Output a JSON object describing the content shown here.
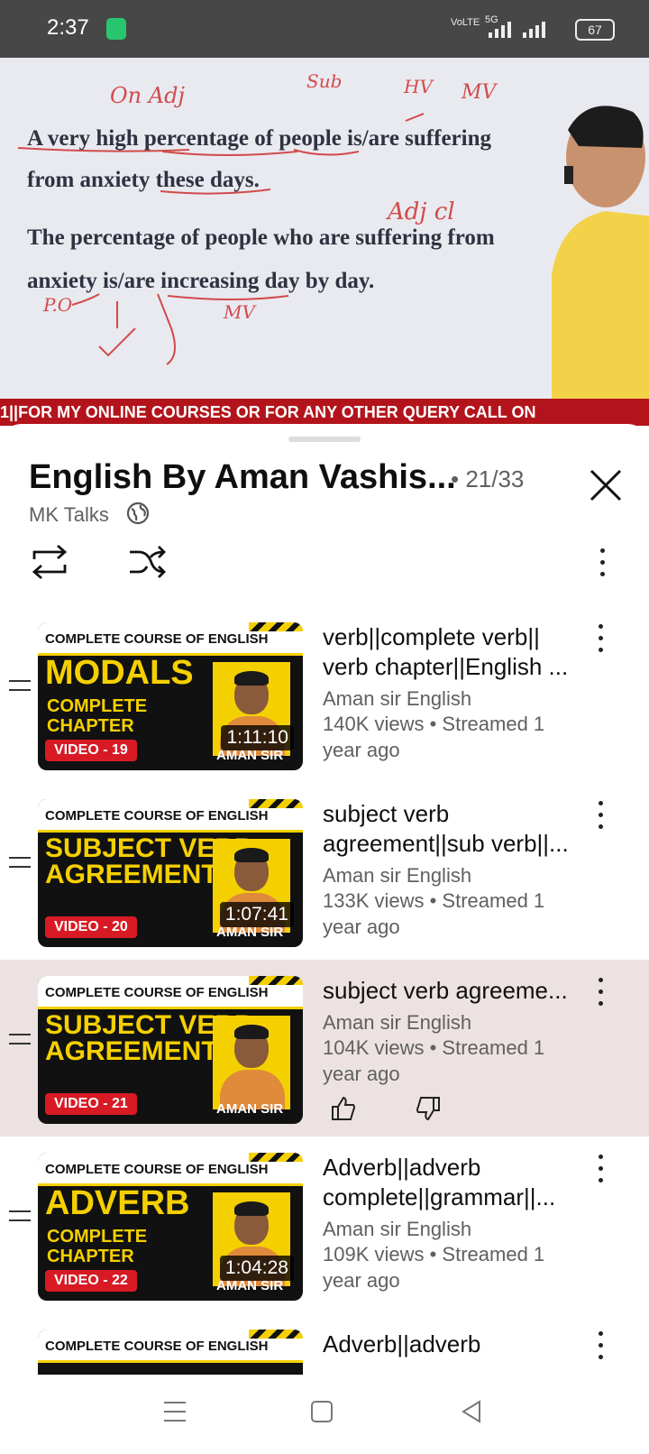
{
  "status": {
    "time": "2:37",
    "net1": "VoLTE",
    "net2": "5G",
    "battery": "67"
  },
  "video": {
    "line1": "A very high percentage of people is/are suffering",
    "line2": "from anxiety these days.",
    "line3": "The percentage of people who are suffering from",
    "line4": "anxiety is/are increasing day by day.",
    "ticker": "1||FOR MY ONLINE COURSES OR FOR ANY OTHER QUERY CALL ON"
  },
  "playlist": {
    "title": "English By Aman Vashis...",
    "position": "• 21/33",
    "channel": "MK Talks"
  },
  "items": [
    {
      "band": "COMPLETE COURSE OF ENGLISH",
      "big": "MODALS",
      "sub": [
        "COMPLETE",
        "CHAPTER"
      ],
      "video": "VIDEO - 19",
      "duration": "1:11:10",
      "aman": "AMAN SIR",
      "title": "verb||complete verb|| verb chapter||English ...",
      "channel": "Aman sir English",
      "meta": "140K views • Streamed 1 year ago"
    },
    {
      "band": "COMPLETE COURSE OF ENGLISH",
      "big": "SUBJECT VERB AGREEMENT",
      "sub": [],
      "video": "VIDEO - 20",
      "duration": "1:07:41",
      "aman": "AMAN SIR",
      "title": "subject verb agreement||sub verb||...",
      "channel": "Aman sir English",
      "meta": "133K views • Streamed 1 year ago"
    },
    {
      "band": "COMPLETE COURSE OF ENGLISH",
      "big": "SUBJECT VERB AGREEMENT",
      "sub": [],
      "video": "VIDEO - 21",
      "duration": "",
      "aman": "AMAN SIR",
      "title": "subject verb agreeme...",
      "channel": "Aman sir English",
      "meta": "104K views • Streamed 1 year ago"
    },
    {
      "band": "COMPLETE COURSE OF ENGLISH",
      "big": "ADVERB",
      "sub": [
        "COMPLETE",
        "CHAPTER"
      ],
      "video": "VIDEO - 22",
      "duration": "1:04:28",
      "aman": "AMAN SIR",
      "title": "Adverb||adverb complete||grammar||...",
      "channel": "Aman sir English",
      "meta": "109K views • Streamed 1 year ago"
    },
    {
      "band": "COMPLETE COURSE OF ENGLISH",
      "title": "Adverb||adverb"
    }
  ]
}
